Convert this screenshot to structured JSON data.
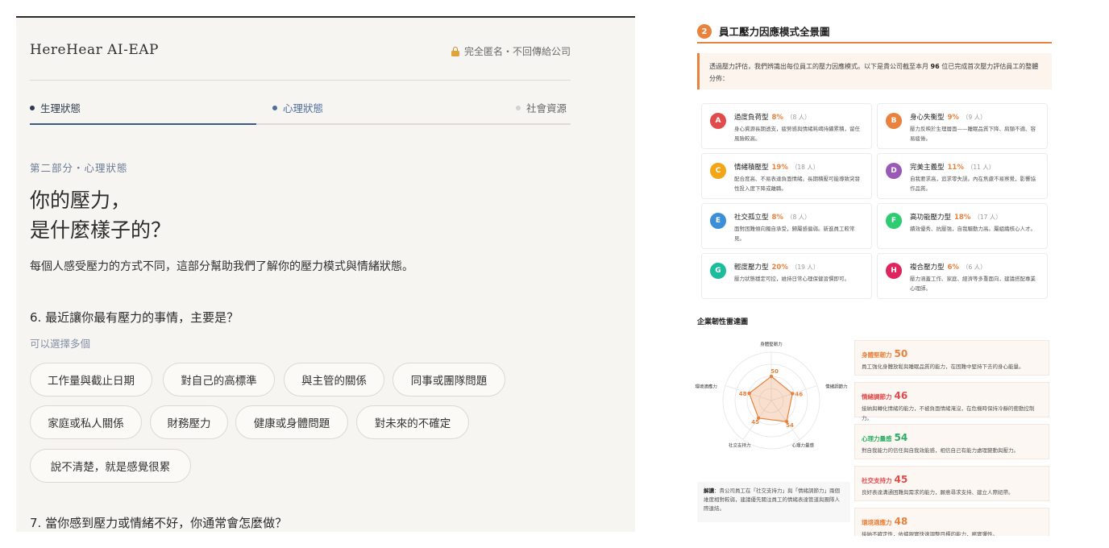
{
  "survey": {
    "brand": "HereHear AI-EAP",
    "privacy_note": "完全匿名・不回傳給公司",
    "tabs": [
      {
        "label": "生理狀態"
      },
      {
        "label": "心理狀態"
      },
      {
        "label": "社會資源"
      }
    ],
    "section_label": "第二部分・心理狀態",
    "headline_line1": "你的壓力，",
    "headline_line2": "是什麼樣子的？",
    "intro": "每個人感受壓力的方式不同，這部分幫助我們了解你的壓力模式與情緒狀態。",
    "q6": {
      "title": "6. 最近讓你最有壓力的事情，主要是？",
      "hint": "可以選擇多個",
      "options": [
        "工作量與截止日期",
        "對自己的高標準",
        "與主管的關係",
        "同事或團隊問題",
        "家庭或私人關係",
        "財務壓力",
        "健康或身體問題",
        "對未來的不確定",
        "說不清楚，就是感覺很累"
      ]
    },
    "q7_title": "7. 當你感到壓力或情緒不好，你通常會怎麼做？"
  },
  "report": {
    "section_number": "2",
    "section_title": "員工壓力因應模式全景圖",
    "callout_pre": "透過壓力評估，我們辨識出每位員工的壓力因應模式。以下是貴公司截至本月 ",
    "callout_count": "96",
    "callout_post": " 位已完成首次壓力評估員工的整體分佈：",
    "types": [
      {
        "letter": "A",
        "name": "過度負荷型",
        "percent": "8%",
        "count": "（8 人）",
        "desc": "身心資源長期透支，疲勞感與情緒耗竭持續累積，留任風險較高。",
        "color": "#e24b4b"
      },
      {
        "letter": "B",
        "name": "身心失衡型",
        "percent": "9%",
        "count": "（9 人）",
        "desc": "壓力反映於生理層面——睡眠品質下降、肩頸不適、容易疲倦。",
        "color": "#e9823d"
      },
      {
        "letter": "C",
        "name": "情緒積壓型",
        "percent": "19%",
        "count": "（18 人）",
        "desc": "配合度高、不易表達負面情緒。長期積壓可能導致突發性投入度下降或離職。",
        "color": "#f2a516"
      },
      {
        "letter": "D",
        "name": "完美主義型",
        "percent": "11%",
        "count": "（11 人）",
        "desc": "自我要求高，追求零失誤。內在焦慮不易察覺，影響協作品質。",
        "color": "#9b59b6"
      },
      {
        "letter": "E",
        "name": "社交孤立型",
        "percent": "8%",
        "count": "（8 人）",
        "desc": "面對困難傾向獨自承受，歸屬感偏弱。新進員工較常見。",
        "color": "#3b8fd9"
      },
      {
        "letter": "F",
        "name": "高功能壓力型",
        "percent": "18%",
        "count": "（17 人）",
        "desc": "績效優秀、抗壓強，自我驅動力高。屬組織核心人才。",
        "color": "#2ecc71"
      },
      {
        "letter": "G",
        "name": "輕度壓力型",
        "percent": "20%",
        "count": "（19 人）",
        "desc": "壓力狀態穩定可控，維持日常心理保健習慣即可。",
        "color": "#1abc9c"
      },
      {
        "letter": "H",
        "name": "複合壓力型",
        "percent": "6%",
        "count": "（6 人）",
        "desc": "壓力涵蓋工作、家庭、經濟等多重面向，建議搭配專業心理師。",
        "color": "#e0245e"
      }
    ],
    "radar_title": "企業韌性雷達圖",
    "chart_data": {
      "type": "radar",
      "axes": [
        "身體堅韌力",
        "情緒調節力",
        "心理力量感",
        "社交支持力",
        "環境適應力"
      ],
      "values": [
        50,
        46,
        54,
        45,
        48
      ],
      "max": 100,
      "color": "#e9823d"
    },
    "note_label": "解讀",
    "note_text": "：貴公司員工在「社交支持力」與「情緒調節力」兩個維度相對較弱，建議優先關注員工的情緒表達管道與團隊人際連結。",
    "metrics": [
      {
        "name": "身體堅韌力",
        "value": "50",
        "desc": "員工強化身體放鬆與睡眠品質的能力，在困難中堅持下去的身心能量。",
        "color": "#e9823d"
      },
      {
        "name": "情緒調節力",
        "value": "46",
        "desc": "接納與轉化情緒的能力，不被負面情緒淹沒，在危機時保持冷靜的衝動控制力。",
        "color": "#e24b4b"
      },
      {
        "name": "心理力量感",
        "value": "54",
        "desc": "對自我能力的信任與自我效能感，相信自己有能力處理變動與壓力。",
        "color": "#27ae60"
      },
      {
        "name": "社交支持力",
        "value": "45",
        "desc": "良好表達溝通困難與需求的能力，願意尋求支持、建立人際紐帶。",
        "color": "#e24b4b"
      },
      {
        "name": "環境適應力",
        "value": "48",
        "desc": "接納不確定性，依據現實快速調整目標的能力，務實彈性。",
        "color": "#e9823d"
      }
    ]
  }
}
